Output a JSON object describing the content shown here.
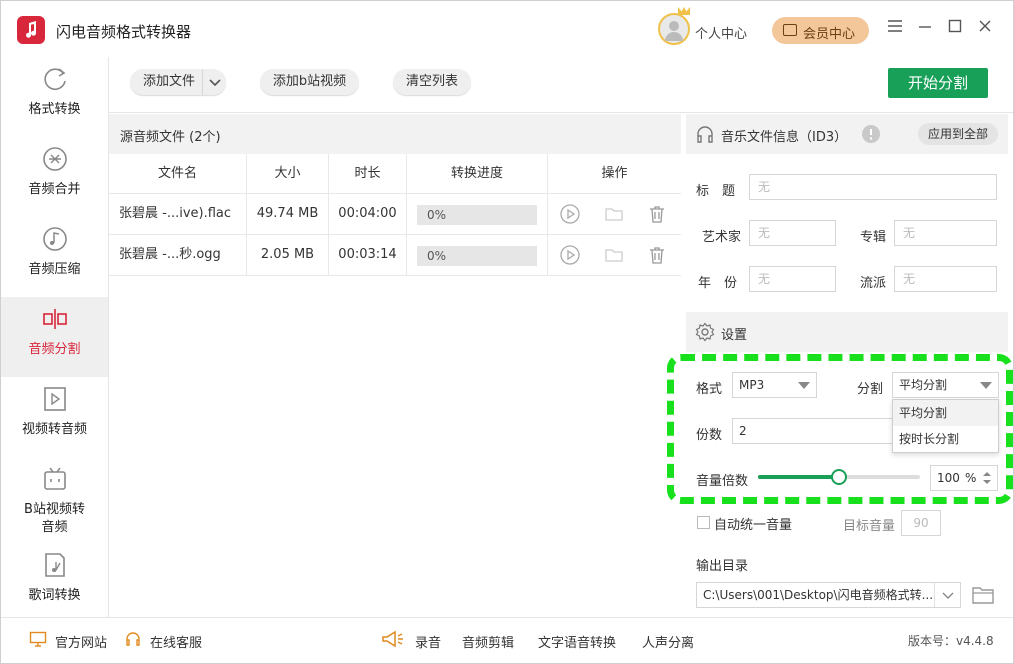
{
  "app": {
    "title": "闪电音频格式转换器",
    "personal_center": "个人中心",
    "vip_center": "会员中心"
  },
  "window_controls": [
    "menu",
    "minimize",
    "maximize",
    "close"
  ],
  "sidebar": {
    "items": [
      {
        "label": "格式转换",
        "icon": "refresh-icon"
      },
      {
        "label": "音频合并",
        "icon": "merge-icon"
      },
      {
        "label": "音频压缩",
        "icon": "music-note-icon"
      },
      {
        "label": "音频分割",
        "icon": "split-icon",
        "active": true
      },
      {
        "label": "视频转音频",
        "icon": "video-icon"
      },
      {
        "label": "B站视频转\n音频",
        "icon": "bilibili-icon"
      },
      {
        "label": "歌词转换",
        "icon": "lyrics-icon"
      }
    ]
  },
  "toolbar": {
    "add_file": "添加文件",
    "add_bilibili": "添加b站视频",
    "clear_list": "清空列表",
    "start_split": "开始分割"
  },
  "file_list": {
    "title": "源音频文件 (2个)",
    "columns": [
      "文件名",
      "大小",
      "时长",
      "转换进度",
      "操作"
    ],
    "rows": [
      {
        "name": "张碧晨 -...ive).flac",
        "size": "49.74 MB",
        "duration": "00:04:00",
        "progress": "0%"
      },
      {
        "name": "张碧晨 -...秒.ogg",
        "size": "2.05 MB",
        "duration": "00:03:14",
        "progress": "0%"
      }
    ]
  },
  "music_info": {
    "title": "音乐文件信息（ID3）",
    "apply_all": "应用到全部",
    "fields": {
      "title_label": "标　题",
      "title_value": "无",
      "artist_label": "艺术家",
      "artist_value": "无",
      "album_label": "专辑",
      "album_value": "无",
      "year_label": "年　份",
      "year_value": "无",
      "genre_label": "流派",
      "genre_value": "无"
    }
  },
  "settings": {
    "title": "设置",
    "format_label": "格式",
    "format_value": "MP3",
    "split_label": "分割",
    "split_value": "平均分割",
    "split_options": [
      "平均分割",
      "按时长分割"
    ],
    "parts_label": "份数",
    "parts_value": "2",
    "volume_label": "音量倍数",
    "volume_value": "100",
    "volume_unit": "%",
    "volume_fraction": 0.5,
    "auto_volume_label": "自动统一音量",
    "target_volume_label": "目标音量",
    "target_volume_value": "90",
    "output_label": "输出目录",
    "output_path": "C:\\Users\\001\\Desktop\\闪电音频格式转..."
  },
  "footer": {
    "website": "官方网站",
    "support": "在线客服",
    "record": "录音",
    "audio_edit": "音频剪辑",
    "tts": "文字语音转换",
    "vocal_sep": "人声分离",
    "version": "版本号：v4.4.8"
  },
  "colors": {
    "accent_red": "#d8263a",
    "accent_green": "#18a058",
    "highlight_dash": "#19e01c"
  }
}
